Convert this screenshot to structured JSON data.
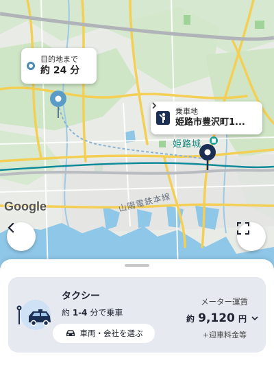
{
  "map": {
    "labels": {
      "sanyo_line": "山陽電鉄本線",
      "himeji_castle": "姫路城"
    },
    "google_logo": "Google",
    "colors": {
      "background": "#e9ece6",
      "green": "#c9e4c2",
      "water": "#8fc7e8",
      "major_road": "#f4cf55",
      "rail": "#0f8a9a"
    },
    "destination_pin_icon": "destination-pin-icon",
    "pickup_pin_icon": "pickup-pin-icon"
  },
  "destination_callout": {
    "label": "目的地まで",
    "duration": "約 24 分"
  },
  "pickup_callout": {
    "label": "乗車地",
    "address": "姫路市豊沢町1...",
    "icon": "person-waving-icon"
  },
  "map_controls": {
    "back_icon": "chevron-left-icon",
    "expand_icon": "fullscreen-icon"
  },
  "sheet": {
    "service": {
      "name": "タクシー",
      "eta_prefix": "約",
      "eta_range": "1-4",
      "eta_suffix": "分で乗車",
      "vehicle_icon": "taxi-vehicle-icon",
      "select_label": "車両・会社を選ぶ"
    },
    "fare": {
      "label": "メーター運賃",
      "prefix": "約",
      "amount": "9,120",
      "unit": "円",
      "note": "+迎車料金等"
    },
    "colors": {
      "card_bg": "#e6eaf0",
      "accent_dark": "#1b2f55"
    }
  }
}
